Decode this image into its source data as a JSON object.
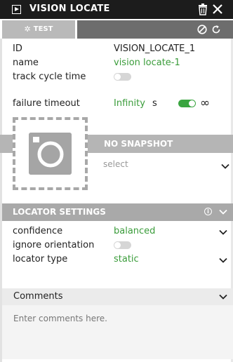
{
  "header": {
    "title": "VISION LOCATE",
    "node_icon": "play-square-icon",
    "trash_icon": "trash-icon",
    "close_icon": "close-icon"
  },
  "toolbar": {
    "test_label": "TEST",
    "test_icon": "gear-icon",
    "disable_icon": "ban-icon",
    "reset_icon": "reset-icon"
  },
  "properties": {
    "id_label": "ID",
    "id_value": "VISION_LOCATE_1",
    "name_label": "name",
    "name_value": "vision locate-1",
    "track_label": "track cycle time",
    "track_on": false,
    "failure_label": "failure timeout",
    "failure_value": "Infinity",
    "failure_unit": "s",
    "infinity_on": true,
    "infinity_symbol": "∞"
  },
  "snapshot": {
    "title": "NO SNAPSHOT",
    "select_placeholder": "select",
    "camera_icon": "camera-icon"
  },
  "locator": {
    "title": "LOCATOR SETTINGS",
    "info_icon": "info-icon",
    "confidence_label": "confidence",
    "confidence_value": "balanced",
    "ignore_label": "ignore orientation",
    "ignore_on": false,
    "type_label": "locator type",
    "type_value": "static"
  },
  "comments": {
    "title": "Comments",
    "placeholder": "Enter comments here."
  },
  "colors": {
    "accent_green": "#3a9c3a",
    "toggle_on": "#3aa540",
    "header_bg": "#1c1c1c"
  }
}
